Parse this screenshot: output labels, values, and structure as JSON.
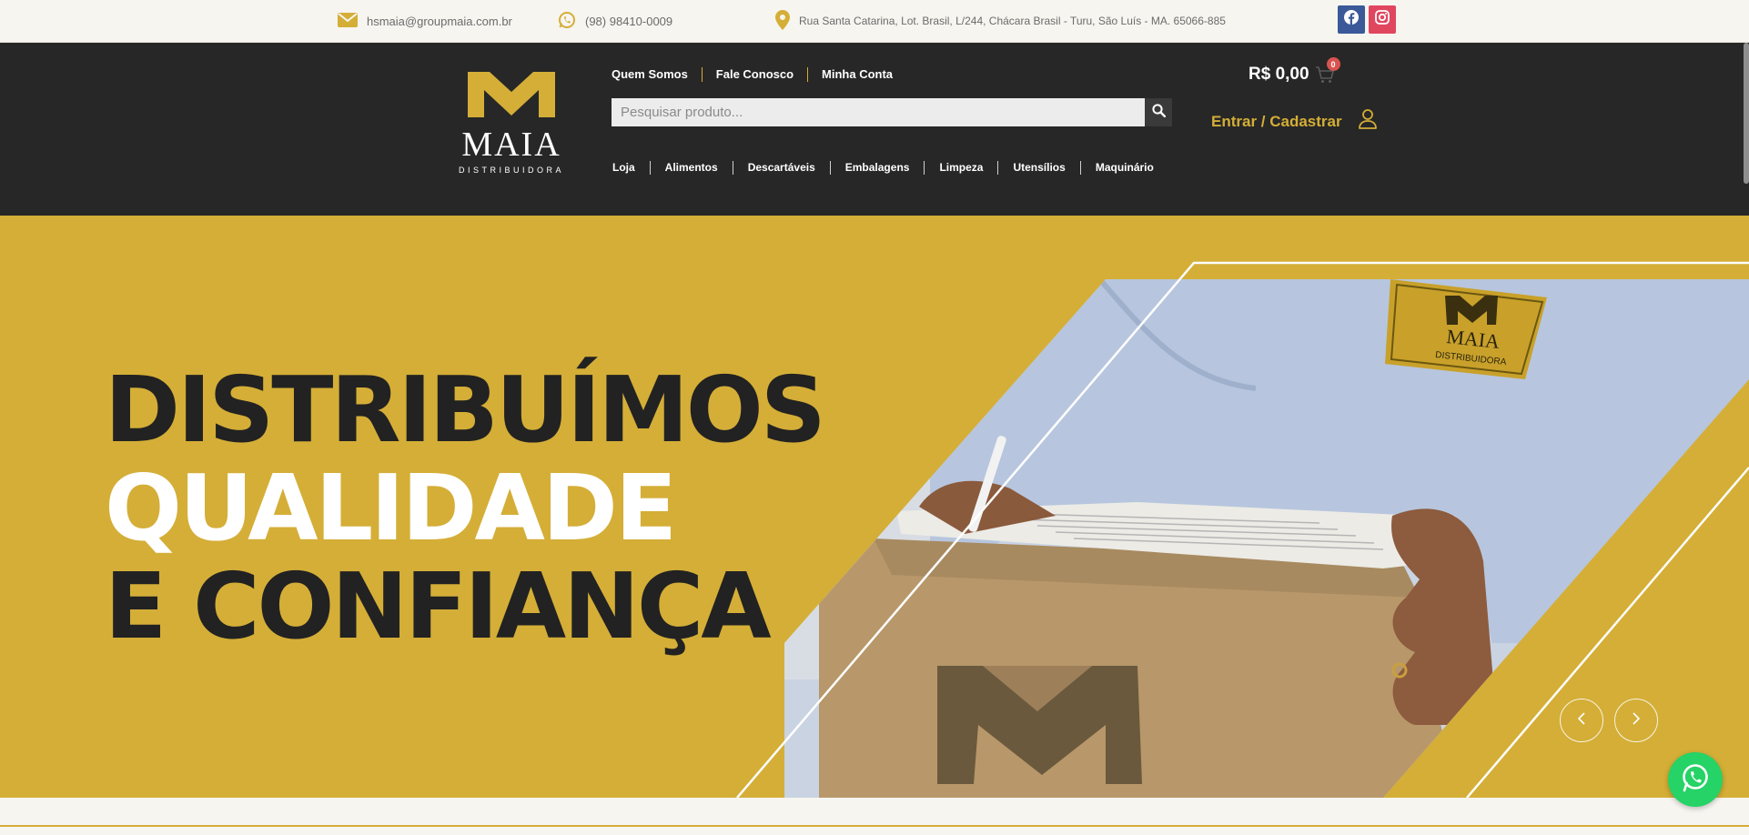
{
  "topbar": {
    "email": "hsmaia@groupmaia.com.br",
    "phone": "(98) 98410-0009",
    "address": "Rua Santa Catarina, Lot. Brasil, L/244, Chácara Brasil - Turu, São Luís - MA. 65066-885",
    "icons": {
      "email": "envelope-icon",
      "phone": "whatsapp-icon",
      "address": "map-pin-icon",
      "facebook": "facebook-icon",
      "instagram": "instagram-icon"
    }
  },
  "logo": {
    "word": "MAIA",
    "sub": "DISTRIBUIDORA"
  },
  "header": {
    "links": [
      "Quem Somos",
      "Fale Conosco",
      "Minha Conta"
    ],
    "search_placeholder": "Pesquisar produto...",
    "nav": [
      "Loja",
      "Alimentos",
      "Descartáveis",
      "Embalagens",
      "Limpeza",
      "Utensílios",
      "Maquinário"
    ],
    "cart_total": "R$ 0,00",
    "cart_count": "0",
    "login": "Entrar / Cadastrar"
  },
  "hero": {
    "line1": "DISTRIBUÍMOS",
    "line2": "QUALIDADE",
    "line3": "E CONFIANÇA",
    "patch_word": "MAIA",
    "patch_sub": "DISTRIBUIDORA"
  },
  "colors": {
    "gold": "#d4ae37",
    "dark": "#272727",
    "whatsapp": "#25d366"
  }
}
